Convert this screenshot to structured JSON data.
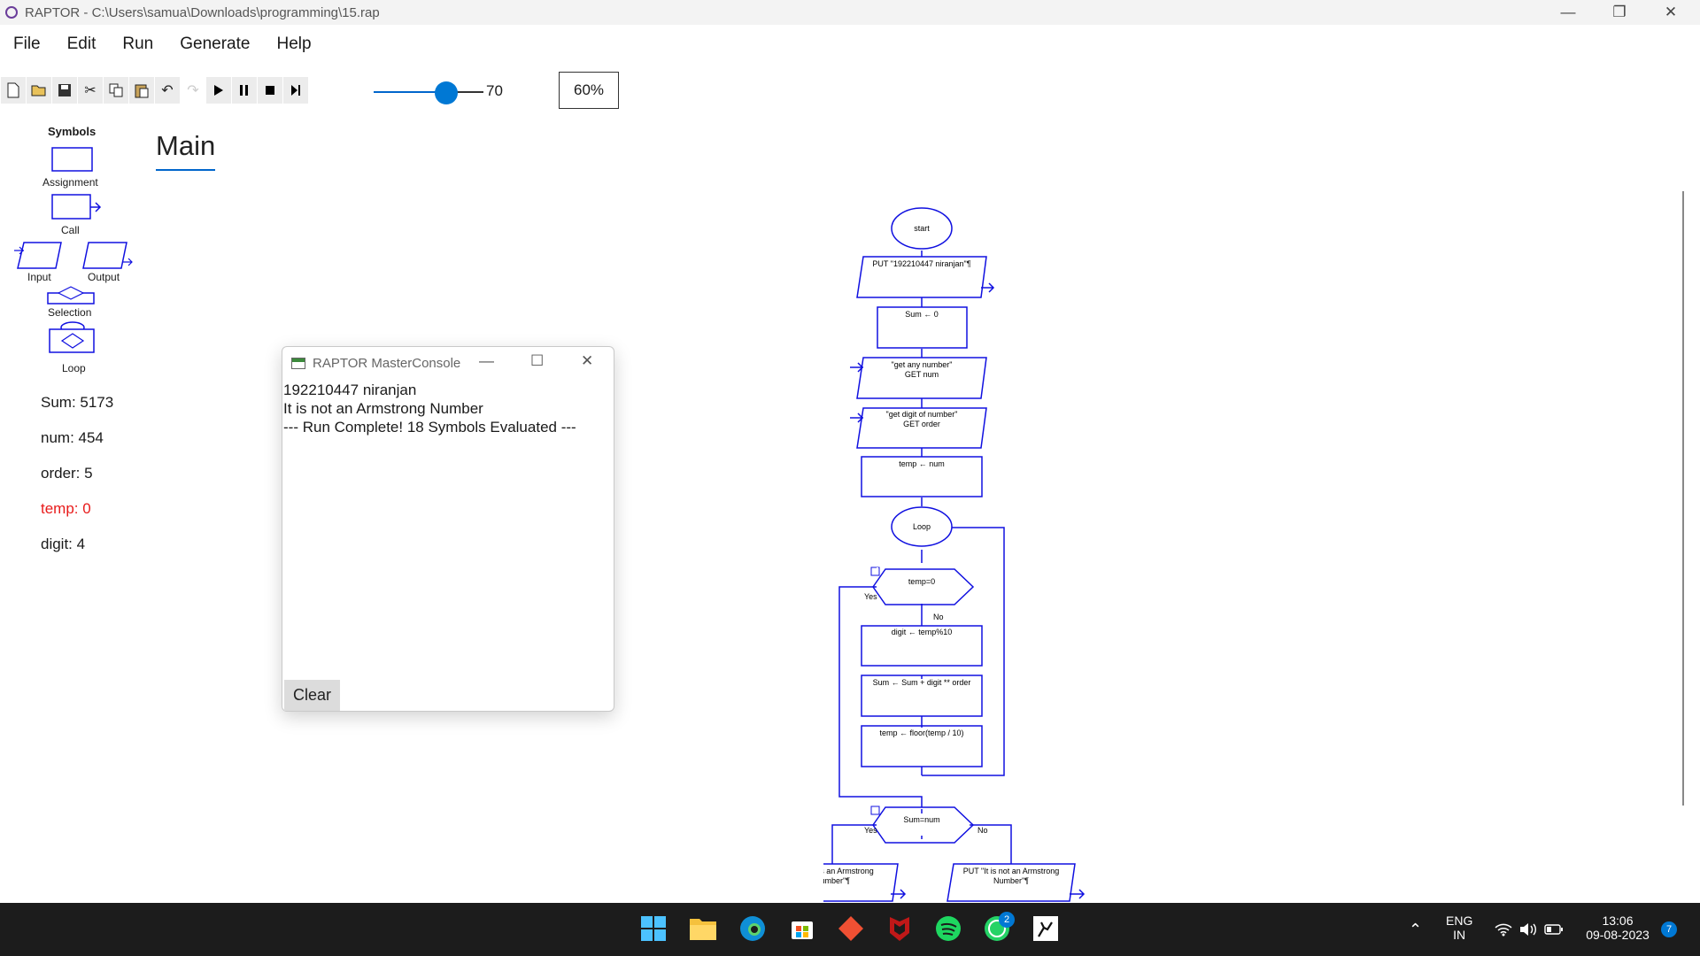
{
  "window": {
    "title": "RAPTOR - C:\\Users\\samua\\Downloads\\programming\\15.rap",
    "minimize": "—",
    "restore": "❐",
    "close": "✕"
  },
  "menu": {
    "items": [
      "File",
      "Edit",
      "Run",
      "Generate",
      "Help"
    ]
  },
  "toolbar": {
    "speed_value": "70",
    "zoom": "60%"
  },
  "symbols": {
    "title": "Symbols",
    "assignment": "Assignment",
    "call": "Call",
    "input": "Input",
    "output": "Output",
    "selection": "Selection",
    "loop": "Loop"
  },
  "variables": [
    {
      "text": "Sum: 5173",
      "changed": false
    },
    {
      "text": "num: 454",
      "changed": false
    },
    {
      "text": "order: 5",
      "changed": false
    },
    {
      "text": "temp: 0",
      "changed": true
    },
    {
      "text": "digit: 4",
      "changed": false
    }
  ],
  "tab": {
    "label": "Main"
  },
  "console": {
    "title": "RAPTOR MasterConsole",
    "lines": [
      "192210447 niranjan",
      "It is not an Armstrong Number",
      "--- Run Complete! 18 Symbols Evaluated ---"
    ],
    "clear_label": "Clear"
  },
  "flowchart": {
    "start": "start",
    "put1": "PUT \"192210447 niranjan\"¶",
    "sum_init": "Sum ← 0",
    "get_num_prompt": "\"get any number\"",
    "get_num": "GET num",
    "get_order_prompt": "\"get digit of number\"",
    "get_order": "GET order",
    "temp_assign": "temp ← num",
    "loop": "Loop",
    "cond1": "temp=0",
    "yes1": "Yes",
    "no1": "No",
    "digit_assign": "digit ← temp%10",
    "sum_assign": "Sum ← Sum + digit ** order",
    "temp_floor": "temp ← floor(temp / 10)",
    "cond2": "Sum=num",
    "yes2": "Yes",
    "no2": "No",
    "put_yes_1": "PUT \"It is an Armstrong",
    "put_yes_2": "Number\"¶",
    "put_no_1": "PUT \"It is not an Armstrong",
    "put_no_2": "Number\"¶"
  },
  "taskbar": {
    "lang_1": "ENG",
    "lang_2": "IN",
    "time": "13:06",
    "date": "09-08-2023",
    "notification_count": "7",
    "whatsapp_badge": "2"
  }
}
